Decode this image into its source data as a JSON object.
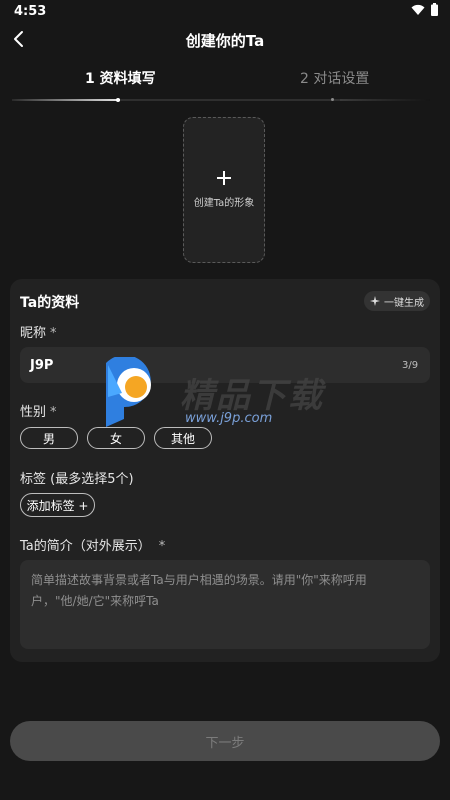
{
  "status_bar": {
    "time": "4:53"
  },
  "header": {
    "title": "创建你的Ta"
  },
  "steps": [
    {
      "label": "1 资料填写",
      "active": true
    },
    {
      "label": "2 对话设置",
      "active": false
    }
  ],
  "progress": {
    "current_step": 1,
    "total_steps": 2
  },
  "avatar_upload": {
    "label": "创建Ta的形象",
    "icon": "plus-icon"
  },
  "profile_card": {
    "title": "Ta的资料",
    "generate_label": "一键生成",
    "nickname": {
      "label": "昵称",
      "required_mark": "*",
      "value": "J9P",
      "count": "3/9"
    },
    "gender": {
      "label": "性别",
      "required_mark": "*",
      "options": [
        "男",
        "女",
        "其他"
      ]
    },
    "tags": {
      "label": "标签 (最多选择5个)",
      "add_label": "添加标签 +"
    },
    "intro": {
      "label": "Ta的简介（对外展示）",
      "required_mark": "*",
      "placeholder": "简单描述故事背景或者Ta与用户相遇的场景。请用\"你\"来称呼用户，\"他/她/它\"来称呼Ta"
    }
  },
  "next_button": {
    "label": "下一步"
  },
  "watermark": {
    "text": "精品下载",
    "url": "www.j9p.com"
  },
  "colors": {
    "background": "#171717",
    "card": "#222222",
    "field": "#2d2d2d",
    "button_disabled": "#4a4a4a"
  }
}
